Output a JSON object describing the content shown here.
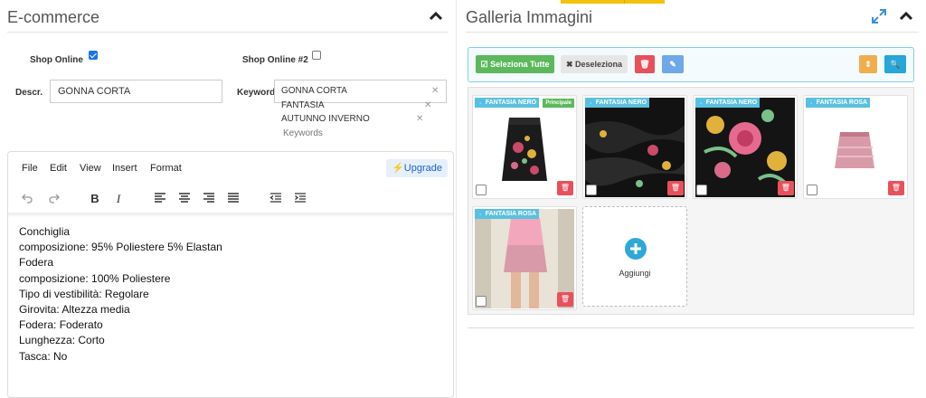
{
  "left": {
    "title": "E-commerce",
    "shop_online_label": "Shop Online",
    "shop_online_checked": true,
    "shop_online2_label": "Shop Online #2",
    "shop_online2_checked": false,
    "descr_label": "Descr.",
    "descr_value": "GONNA CORTA",
    "keywords_label": "Keywords",
    "keywords": [
      "GONNA CORTA",
      "FANTASIA",
      "AUTUNNO INVERNO"
    ],
    "keywords_placeholder": "Keywords"
  },
  "editor": {
    "menu": [
      "File",
      "Edit",
      "View",
      "Insert",
      "Format"
    ],
    "upgrade_label": "Upgrade",
    "toolbar_icons": [
      "undo-icon",
      "redo-icon",
      "bold-icon",
      "italic-icon",
      "align-left-icon",
      "align-center-icon",
      "align-right-icon",
      "align-justify-icon",
      "outdent-icon",
      "indent-icon"
    ],
    "lines": [
      "Conchiglia",
      "composizione: 95% Poliestere 5% Elastan",
      "Fodera",
      "composizione: 100% Poliestere",
      "Tipo di vestibilità: Regolare",
      "Girovita: Altezza media",
      "Fodera: Foderato",
      "Lunghezza: Corto",
      "Tasca: No"
    ]
  },
  "right": {
    "title": "Galleria Immagini",
    "select_all_label": "Seleziona Tutte",
    "deselect_label": "Deseleziona",
    "add_label": "Aggiungi",
    "images": [
      {
        "badge": "FANTASIA NERO",
        "principal": "Principale",
        "kind": "black-skirt"
      },
      {
        "badge": "FANTASIA NERO",
        "principal": "",
        "kind": "black-fabric"
      },
      {
        "badge": "FANTASIA NERO",
        "principal": "",
        "kind": "floral"
      },
      {
        "badge": "FANTASIA ROSA",
        "principal": "",
        "kind": "pink-skirt"
      },
      {
        "badge": "FANTASIA ROSA",
        "principal": "",
        "kind": "model"
      }
    ]
  },
  "colors": {
    "accent_blue": "#1a73e8",
    "badge_blue": "#5bc0de",
    "success_green": "#5cb85c",
    "danger_red": "#e8505b",
    "warning_yellow": "#f0ad4e"
  }
}
